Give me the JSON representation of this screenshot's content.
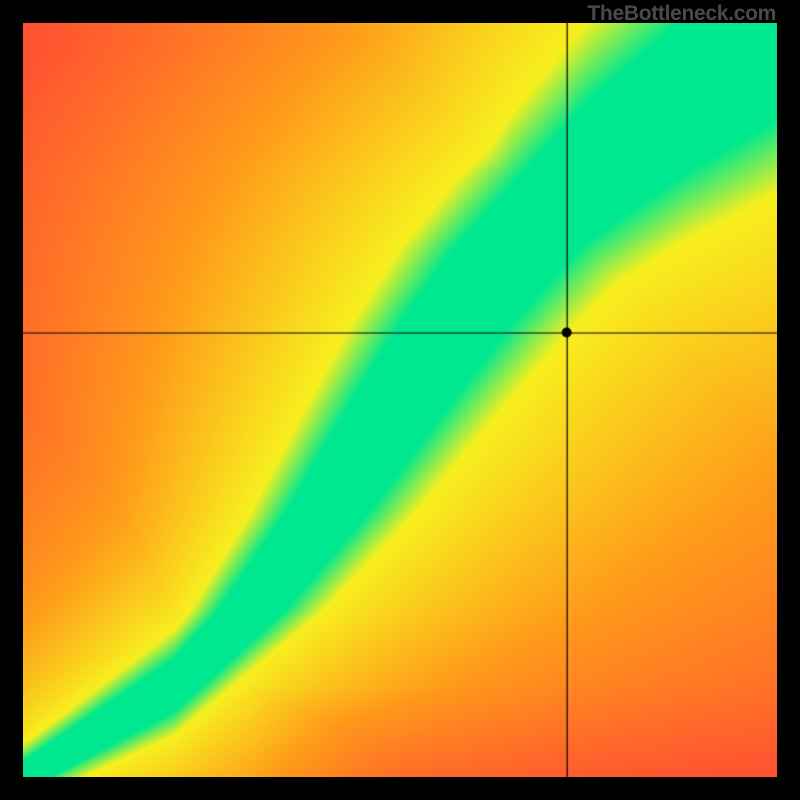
{
  "watermark": "TheBottleneck.com",
  "chart_data": {
    "type": "heatmap",
    "title": "",
    "xlabel": "",
    "ylabel": "",
    "xlim": [
      0,
      1
    ],
    "ylim": [
      0,
      1
    ],
    "crosshair": {
      "x": 0.722,
      "y": 0.589
    },
    "marker": {
      "x": 0.722,
      "y": 0.589
    },
    "optimal_band": {
      "description": "green optimal curve with yellow halo on red-orange gradient background",
      "center_curve": [
        {
          "x": 0.0,
          "y": 0.0
        },
        {
          "x": 0.1,
          "y": 0.06
        },
        {
          "x": 0.2,
          "y": 0.12
        },
        {
          "x": 0.3,
          "y": 0.22
        },
        {
          "x": 0.4,
          "y": 0.35
        },
        {
          "x": 0.5,
          "y": 0.5
        },
        {
          "x": 0.57,
          "y": 0.6
        },
        {
          "x": 0.65,
          "y": 0.7
        },
        {
          "x": 0.75,
          "y": 0.8
        },
        {
          "x": 0.88,
          "y": 0.9
        },
        {
          "x": 1.0,
          "y": 0.98
        }
      ],
      "band_half_width": 0.05
    },
    "gradient_stops": {
      "optimal": "#00e88f",
      "near": "#f7ef1e",
      "mid": "#ff9a1a",
      "far": "#ff2a3e"
    }
  }
}
